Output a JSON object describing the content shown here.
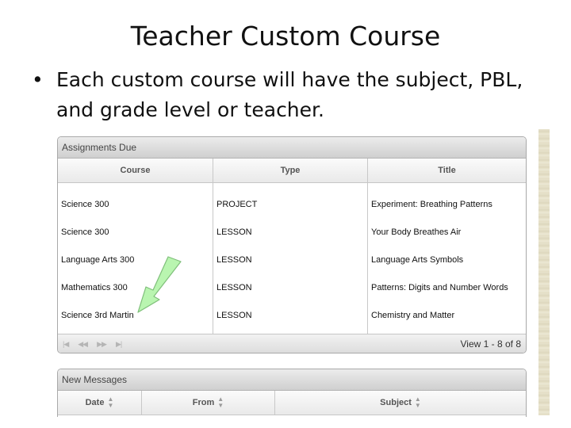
{
  "slide": {
    "title": "Teacher Custom Course",
    "bullet": "Each custom course will have the subject, PBL, and grade level or teacher.",
    "bullet_marker": "•"
  },
  "assignments": {
    "panel_title": "Assignments Due",
    "columns": [
      "Course",
      "Type",
      "Title"
    ],
    "rows": [
      {
        "course": "Science 300",
        "type": "PROJECT",
        "title": "Experiment: Breathing Patterns"
      },
      {
        "course": "Science 300",
        "type": "LESSON",
        "title": "Your Body Breathes Air"
      },
      {
        "course": "Language Arts 300",
        "type": "LESSON",
        "title": "Language Arts Symbols"
      },
      {
        "course": "Mathematics 300",
        "type": "LESSON",
        "title": "Patterns: Digits and Number Words"
      },
      {
        "course": "Science 3rd Martin",
        "type": "LESSON",
        "title": "Chemistry and Matter"
      }
    ],
    "pager": {
      "first_icon": "first-page-icon",
      "prev_icon": "prev-page-icon",
      "next_icon": "next-page-icon",
      "last_icon": "last-page-icon",
      "info": "View 1 - 8 of 8"
    }
  },
  "messages": {
    "panel_title": "New Messages",
    "columns": [
      "Date",
      "From",
      "Subject"
    ],
    "sort_icon": "sort-arrows-icon"
  },
  "annotation": {
    "arrow_color": "#b9f5b0",
    "arrow_icon": "pointer-arrow-icon"
  }
}
